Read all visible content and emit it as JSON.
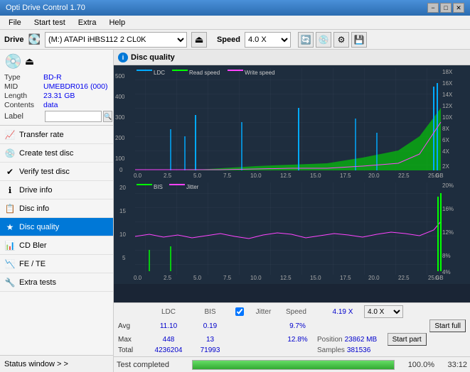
{
  "titleBar": {
    "title": "Opti Drive Control 1.70",
    "minimize": "−",
    "maximize": "□",
    "close": "✕"
  },
  "menuBar": {
    "items": [
      "File",
      "Start test",
      "Extra",
      "Help"
    ]
  },
  "driveBar": {
    "label": "Drive",
    "driveValue": "(M:)  ATAPI iHBS112  2 CL0K",
    "speedLabel": "Speed",
    "speedValue": "4.0 X"
  },
  "discPanel": {
    "typeLabel": "Type",
    "typeValue": "BD-R",
    "midLabel": "MID",
    "midValue": "UMEBDR016 (000)",
    "lengthLabel": "Length",
    "lengthValue": "23.31 GB",
    "contentsLabel": "Contents",
    "contentsValue": "data",
    "labelLabel": "Label"
  },
  "navItems": [
    {
      "id": "transfer-rate",
      "label": "Transfer rate",
      "icon": "📈"
    },
    {
      "id": "create-test-disc",
      "label": "Create test disc",
      "icon": "💿"
    },
    {
      "id": "verify-test-disc",
      "label": "Verify test disc",
      "icon": "✔"
    },
    {
      "id": "drive-info",
      "label": "Drive info",
      "icon": "ℹ"
    },
    {
      "id": "disc-info",
      "label": "Disc info",
      "icon": "📋"
    },
    {
      "id": "disc-quality",
      "label": "Disc quality",
      "icon": "★",
      "active": true
    },
    {
      "id": "cd-bler",
      "label": "CD Bler",
      "icon": "📊"
    },
    {
      "id": "fe-te",
      "label": "FE / TE",
      "icon": "📉"
    },
    {
      "id": "extra-tests",
      "label": "Extra tests",
      "icon": "🔧"
    }
  ],
  "statusWindow": {
    "label": "Status window > >"
  },
  "panelTitle": "Disc quality",
  "legend": {
    "upper": [
      "LDC",
      "Read speed",
      "Write speed"
    ],
    "lower": [
      "BIS",
      "Jitter"
    ]
  },
  "xLabels": [
    "0.0",
    "2.5",
    "5.0",
    "7.5",
    "10.0",
    "12.5",
    "15.0",
    "17.5",
    "20.0",
    "22.5",
    "25.0"
  ],
  "upperYLabels": [
    "500",
    "400",
    "300",
    "200",
    "100",
    "0"
  ],
  "upperYLabelsRight": [
    "18X",
    "16X",
    "14X",
    "12X",
    "10X",
    "8X",
    "6X",
    "4X",
    "2X"
  ],
  "lowerYLabels": [
    "20",
    "15",
    "10",
    "5"
  ],
  "lowerYLabelsRight": [
    "20%",
    "16%",
    "12%",
    "8%",
    "4%"
  ],
  "stats": {
    "columns": [
      "LDC",
      "BIS",
      "",
      "Jitter",
      "Speed",
      ""
    ],
    "rows": [
      {
        "label": "Avg",
        "ldc": "11.10",
        "bis": "0.19",
        "jitter": "9.7%",
        "speed": "4.19 X"
      },
      {
        "label": "Max",
        "ldc": "448",
        "bis": "13",
        "jitter": "12.8%",
        "speed_label": "Position",
        "speed": "23862 MB"
      },
      {
        "label": "Total",
        "ldc": "4236204",
        "bis": "71993",
        "jitter": "",
        "speed_label": "Samples",
        "speed": "381536"
      }
    ],
    "speedDropdown": "4.0 X",
    "startFull": "Start full",
    "startPart": "Start part"
  },
  "bottomBar": {
    "statusText": "Test completed",
    "progressPct": "100.0%",
    "time": "33:12"
  }
}
